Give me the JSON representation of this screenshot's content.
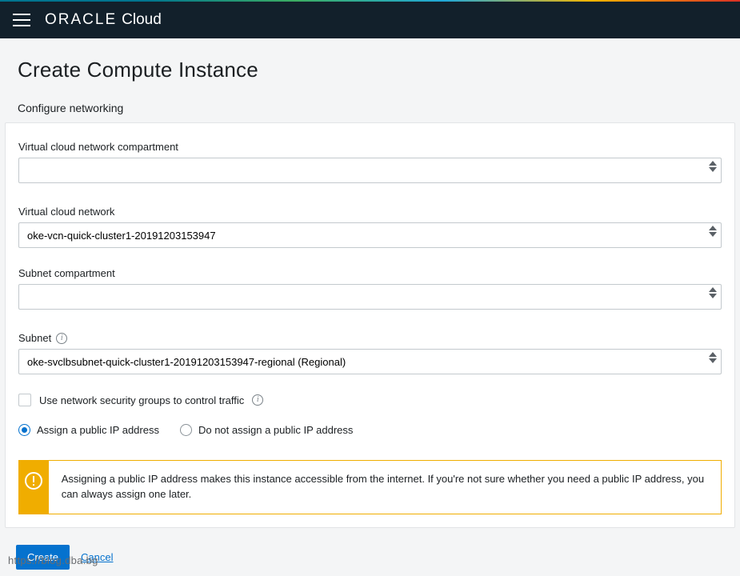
{
  "brand": {
    "oracle": "ORACLE",
    "cloud": "Cloud"
  },
  "page": {
    "title": "Create Compute Instance",
    "section": "Configure networking"
  },
  "fields": {
    "vcn_compartment": {
      "label": "Virtual cloud network compartment",
      "value": ""
    },
    "vcn": {
      "label": "Virtual cloud network",
      "value": "oke-vcn-quick-cluster1-20191203153947"
    },
    "subnet_comp": {
      "label": "Subnet compartment",
      "value": ""
    },
    "subnet": {
      "label": "Subnet",
      "value": "oke-svclbsubnet-quick-cluster1-20191203153947-regional (Regional)"
    }
  },
  "nsg": {
    "label": "Use network security groups to control traffic",
    "checked": false
  },
  "ip": {
    "assign": {
      "label": "Assign a public IP address",
      "checked": true
    },
    "noassign": {
      "label": "Do not assign a public IP address",
      "checked": false
    }
  },
  "alert": {
    "text": "Assigning a public IP address makes this instance accessible from the internet. If you're not sure whether you need a public IP address, you can always assign one later."
  },
  "actions": {
    "create": "Create",
    "cancel": "Cancel"
  },
  "watermark": "https://blog.dba.bg"
}
